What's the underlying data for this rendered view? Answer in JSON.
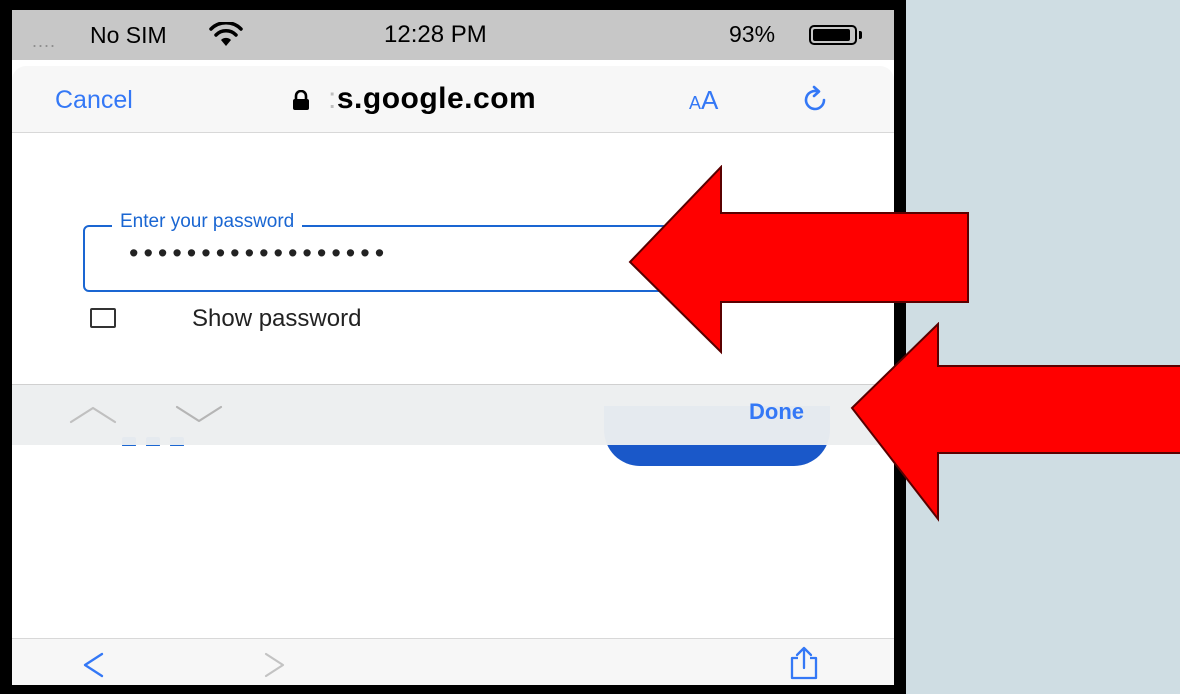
{
  "status_bar": {
    "signal_dots": "....",
    "carrier": "No SIM",
    "wifi_icon": "wifi-icon",
    "time": "12:28 PM",
    "battery_percent": "93%",
    "battery_level": 0.93
  },
  "browser": {
    "cancel_label": "Cancel",
    "url_faded": ":",
    "url": "s.google.com",
    "text_size_small": "A",
    "text_size_large": "A",
    "lock_icon": "lock-icon",
    "reload_icon": "reload-icon"
  },
  "form": {
    "password_label": "Enter your password",
    "password_value": "••••••••••••••••••",
    "show_password_label": "Show password",
    "show_password_checked": false
  },
  "keyboard_accessory": {
    "prev_icon": "chevron-up-icon",
    "next_icon": "chevron-down-icon",
    "done_label": "Done"
  },
  "bottom_toolbar": {
    "back_icon": "back-icon",
    "forward_icon": "forward-icon",
    "share_icon": "share-icon"
  },
  "annotations": {
    "arrow_color": "#ff0000"
  },
  "colors": {
    "ios_blue": "#3478f6",
    "google_blue": "#1a66d2"
  }
}
